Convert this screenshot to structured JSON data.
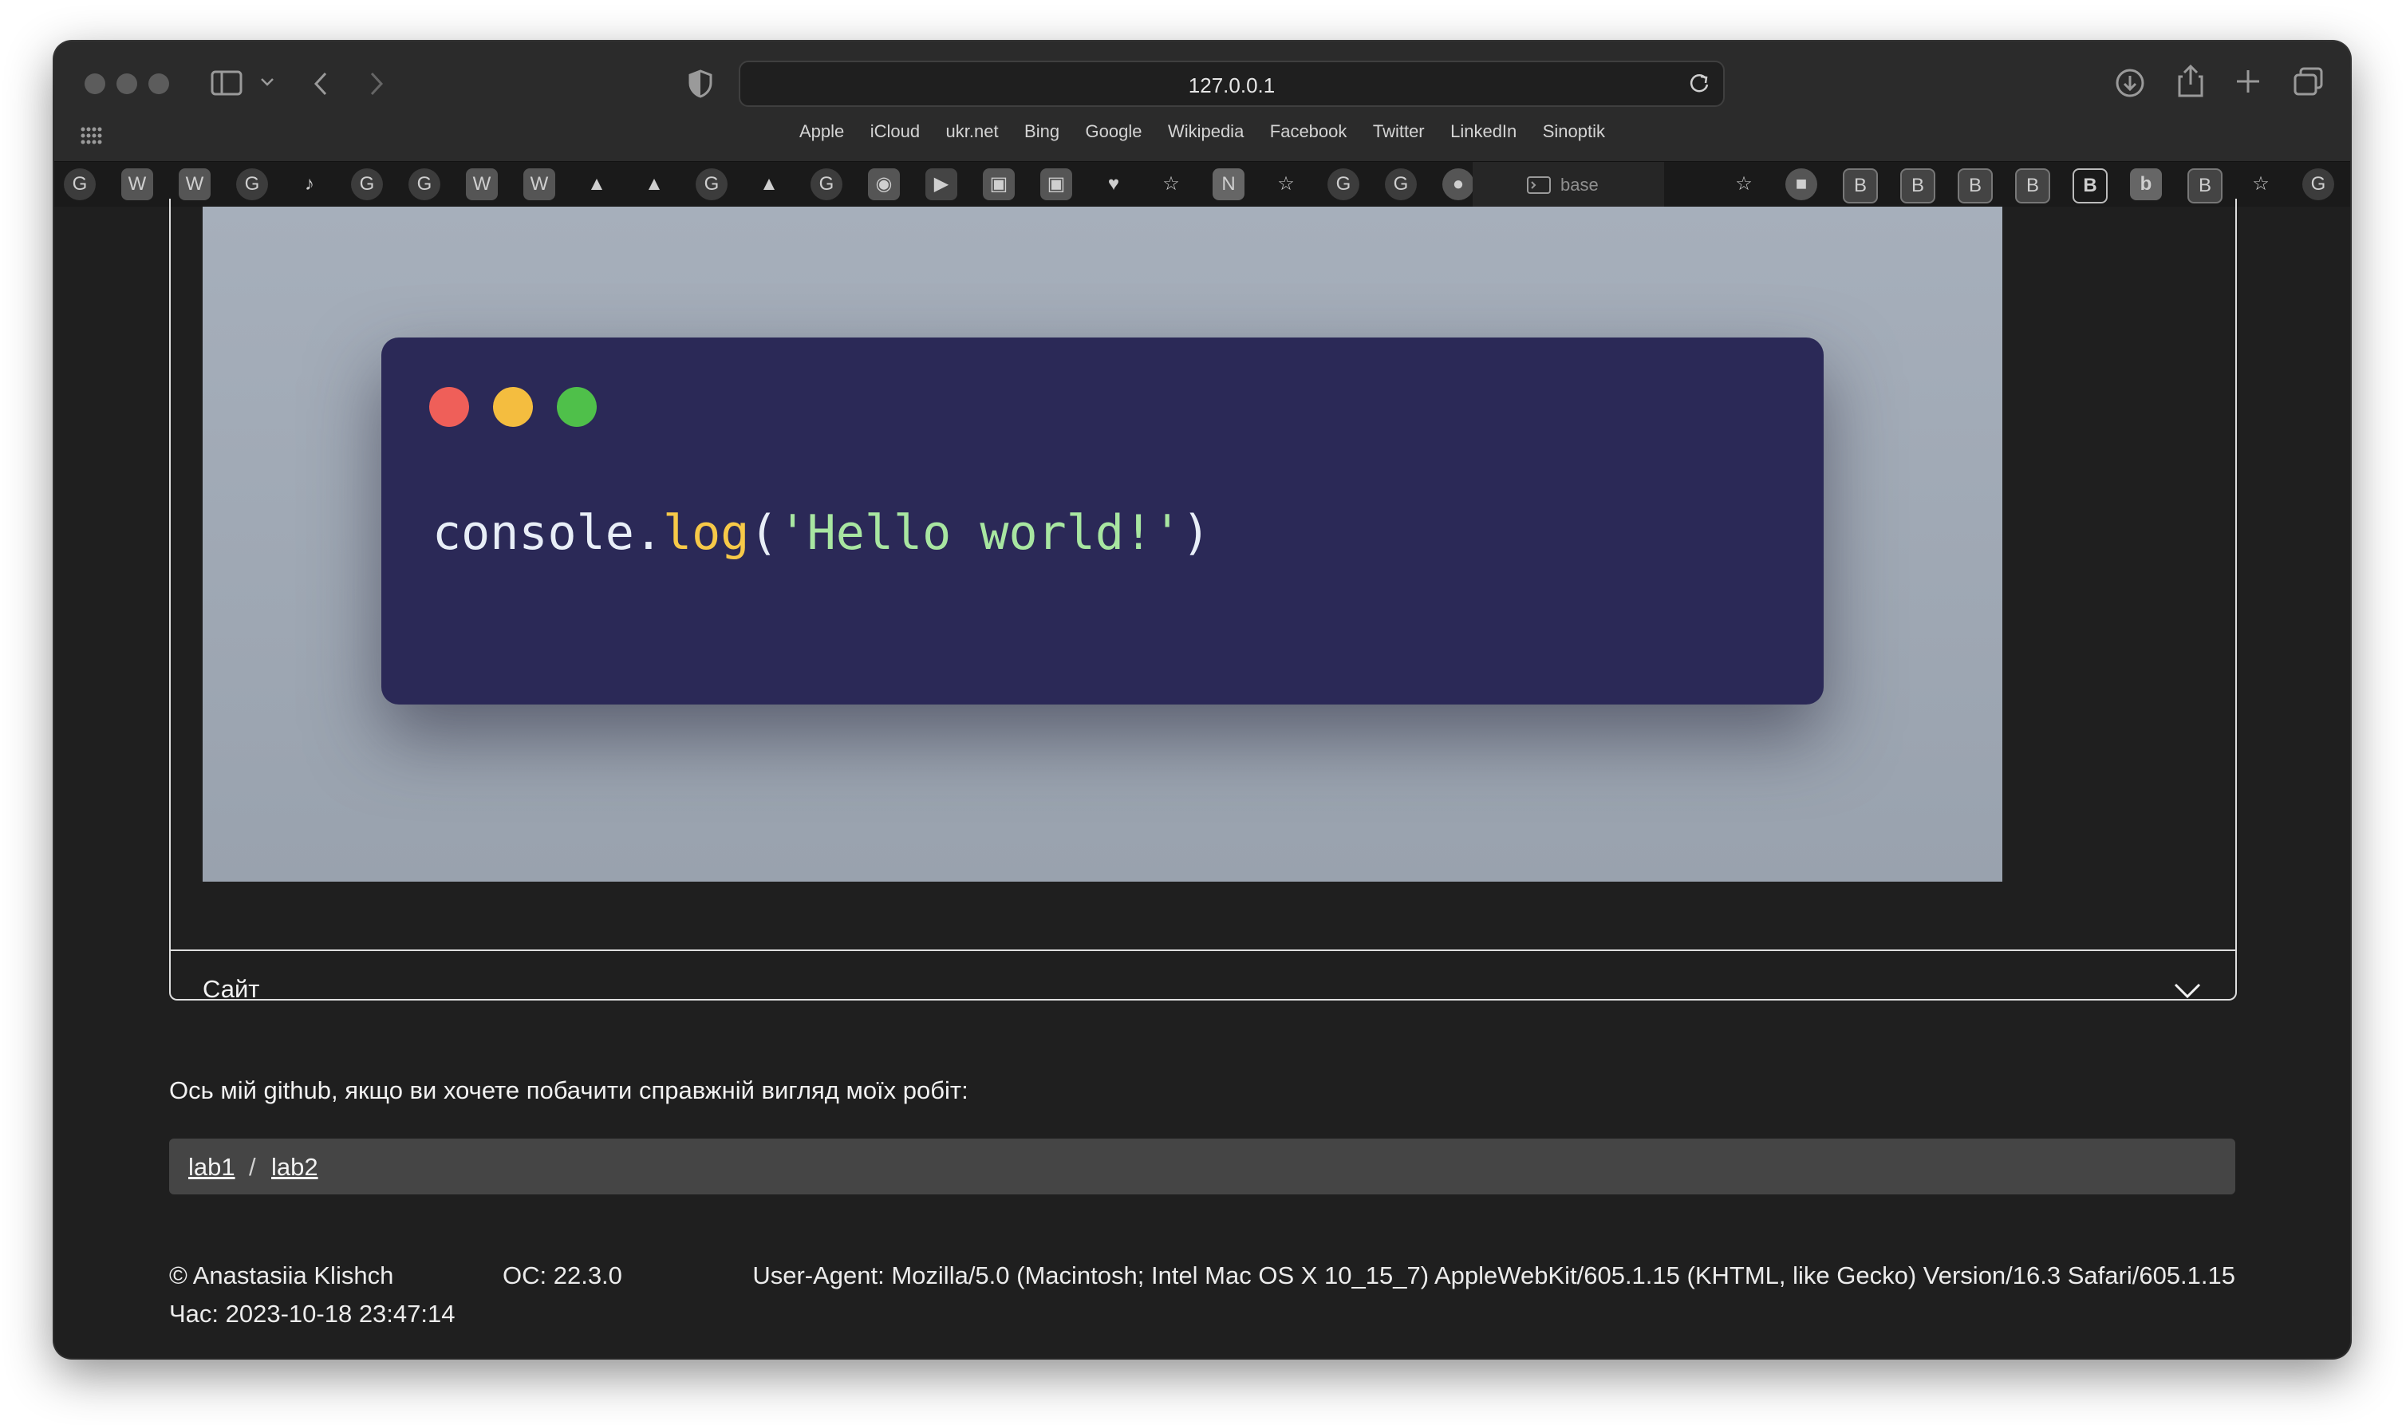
{
  "browser": {
    "url": "127.0.0.1",
    "bookmarks": [
      "Apple",
      "iCloud",
      "ukr.net",
      "Bing",
      "Google",
      "Wikipedia",
      "Facebook",
      "Twitter",
      "LinkedIn",
      "Sinoptik"
    ],
    "active_tab_label": "base"
  },
  "code_card": {
    "object": "console",
    "dot": ".",
    "method": "log",
    "open_paren": "(",
    "string": "'Hello world!'",
    "close_paren": ")",
    "colors": {
      "background": "#2b2957",
      "red": "#ef5f59",
      "yellow": "#f4bd3f",
      "green": "#4fc04a",
      "method": "#f7c948",
      "string": "#a8e6a1"
    }
  },
  "accordion": {
    "header": "Сайт"
  },
  "github": {
    "intro": "Ось мій github, якщо ви хочете побачити справжній вигляд моїх робіт:",
    "links": [
      "lab1",
      "lab2"
    ],
    "separator": "/"
  },
  "footer": {
    "copyright": "© Anastasiia Klishch",
    "os": "ОС: 22.3.0",
    "time": "Час: 2023-10-18 23:47:14",
    "user_agent": "User-Agent: Mozilla/5.0 (Macintosh; Intel Mac OS X 10_15_7) AppleWebKit/605.1.15 (KHTML, like Gecko) Version/16.3 Safari/605.1.15"
  }
}
